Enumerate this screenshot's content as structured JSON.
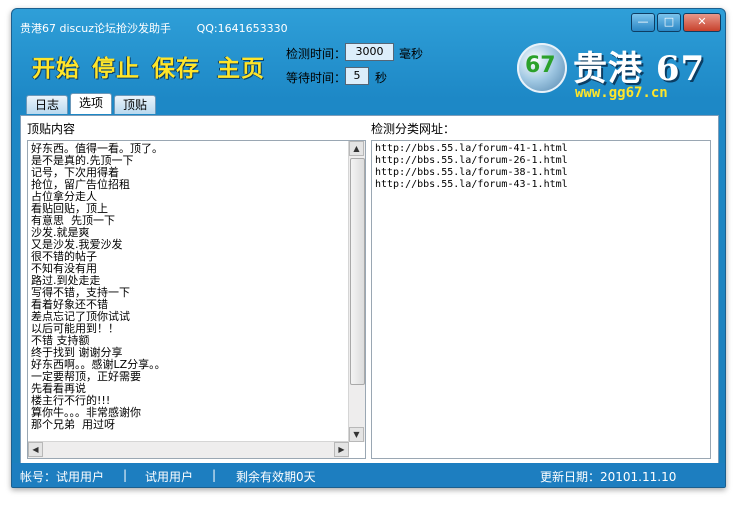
{
  "window": {
    "title": "贵港67 discuz论坛抢沙发助手",
    "qq": "QQ:1641653330",
    "buttons": [
      "minimize",
      "maximize",
      "close"
    ]
  },
  "toolbar": {
    "start": "开始",
    "stop": "停止",
    "save": "保存",
    "home": "主页"
  },
  "settings": {
    "detect_label": "检测时间：",
    "detect_value": "3000",
    "detect_unit": "毫秒",
    "wait_label": "等待时间：",
    "wait_value": "5",
    "wait_unit": "秒"
  },
  "logo": {
    "title": "贵港 67",
    "url": "www.gg67.cn",
    "emblem_text": "67"
  },
  "tabs": [
    "日志",
    "选项",
    "顶贴"
  ],
  "active_tab": "选项",
  "panel": {
    "left_label": "顶贴内容",
    "right_label": "检测分类网址：",
    "replies": "好东西。值得一看。顶了。\n是不是真的.先顶一下\n记号，下次用得着\n抢位，留广告位招租\n占位拿分走人\n看贴回贴，顶上\n有意思  先顶一下\n沙发.就是爽\n又是沙发.我爱沙发\n很不错的帖子\n不知有没有用\n路过.到处走走\n写得不错，支持一下\n看着好象还不错\n差点忘记了顶你试试\n以后可能用到！！\n不错 支持额\n终于找到 谢谢分享\n好东西啊。。感谢LZ分享。。\n一定要帮顶，正好需要\n先看看再说\n楼主行不行的!!!\n算你牛。。。非常感谢你\n那个兄弟  用过呀",
    "urls": "http://bbs.55.la/forum-41-1.html\nhttp://bbs.55.la/forum-26-1.html\nhttp://bbs.55.la/forum-38-1.html\nhttp://bbs.55.la/forum-43-1.html"
  },
  "statusbar": {
    "account": "帐号：试用用户",
    "sep1": "|",
    "user": "试用用户",
    "sep2": "|",
    "remaining": "剩余有效期0天",
    "updated": "更新日期：20101.11.10"
  },
  "colors": {
    "window_blue": "#1d88c6",
    "button_yellow": "#ffe52a",
    "statusbar_blue": "#1d7ec0"
  }
}
